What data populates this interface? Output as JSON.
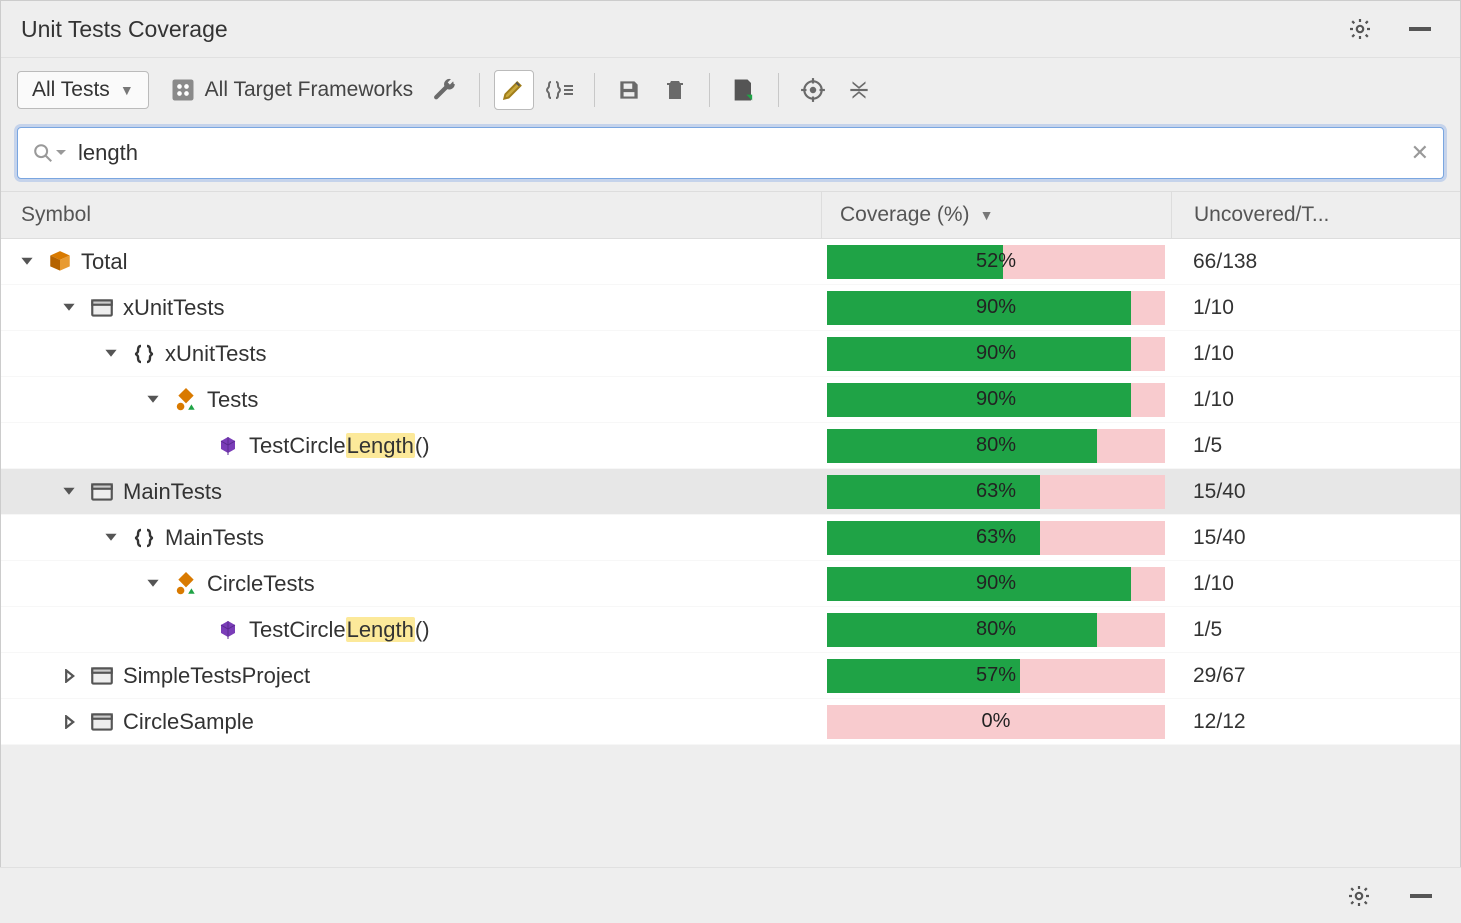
{
  "panel_title": "Unit Tests Coverage",
  "toolbar": {
    "dropdown_label": "All Tests",
    "frameworks_label": "All Target Frameworks"
  },
  "search": {
    "value": "length"
  },
  "columns": {
    "symbol": "Symbol",
    "coverage": "Coverage (%)",
    "uncovered": "Uncovered/T..."
  },
  "rows": [
    {
      "indent": 0,
      "expander": "down",
      "icon": "total",
      "label": "Total",
      "highlight": null,
      "suffix": "",
      "coverage": 52,
      "uncovered": "66/138",
      "alt": false
    },
    {
      "indent": 1,
      "expander": "down",
      "icon": "project",
      "label": "xUnitTests",
      "highlight": null,
      "suffix": "",
      "coverage": 90,
      "uncovered": "1/10",
      "alt": false
    },
    {
      "indent": 2,
      "expander": "down",
      "icon": "namespace",
      "label": "xUnitTests",
      "highlight": null,
      "suffix": "",
      "coverage": 90,
      "uncovered": "1/10",
      "alt": false
    },
    {
      "indent": 3,
      "expander": "down",
      "icon": "class",
      "label": "Tests",
      "highlight": null,
      "suffix": "",
      "coverage": 90,
      "uncovered": "1/10",
      "alt": false
    },
    {
      "indent": 4,
      "expander": "blank",
      "icon": "method",
      "label": "TestCircle",
      "highlight": "Length",
      "suffix": "()",
      "coverage": 80,
      "uncovered": "1/5",
      "alt": false
    },
    {
      "indent": 1,
      "expander": "down",
      "icon": "project",
      "label": "MainTests",
      "highlight": null,
      "suffix": "",
      "coverage": 63,
      "uncovered": "15/40",
      "alt": true
    },
    {
      "indent": 2,
      "expander": "down",
      "icon": "namespace",
      "label": "MainTests",
      "highlight": null,
      "suffix": "",
      "coverage": 63,
      "uncovered": "15/40",
      "alt": false
    },
    {
      "indent": 3,
      "expander": "down",
      "icon": "class",
      "label": "CircleTests",
      "highlight": null,
      "suffix": "",
      "coverage": 90,
      "uncovered": "1/10",
      "alt": false
    },
    {
      "indent": 4,
      "expander": "blank",
      "icon": "method",
      "label": "TestCircle",
      "highlight": "Length",
      "suffix": "()",
      "coverage": 80,
      "uncovered": "1/5",
      "alt": false
    },
    {
      "indent": 1,
      "expander": "right",
      "icon": "project",
      "label": "SimpleTestsProject",
      "highlight": null,
      "suffix": "",
      "coverage": 57,
      "uncovered": "29/67",
      "alt": false
    },
    {
      "indent": 1,
      "expander": "right",
      "icon": "project",
      "label": "CircleSample",
      "highlight": null,
      "suffix": "",
      "coverage": 0,
      "uncovered": "12/12",
      "alt": false
    }
  ],
  "chart_data": {
    "type": "bar",
    "title": "Unit Tests Coverage",
    "xlabel": "Symbol",
    "ylabel": "Coverage (%)",
    "ylim": [
      0,
      100
    ],
    "categories": [
      "Total",
      "xUnitTests",
      "xUnitTests ns",
      "Tests",
      "TestCircleLength()",
      "MainTests",
      "MainTests ns",
      "CircleTests",
      "TestCircleLength()",
      "SimpleTestsProject",
      "CircleSample"
    ],
    "values": [
      52,
      90,
      90,
      90,
      80,
      63,
      63,
      90,
      80,
      57,
      0
    ]
  }
}
